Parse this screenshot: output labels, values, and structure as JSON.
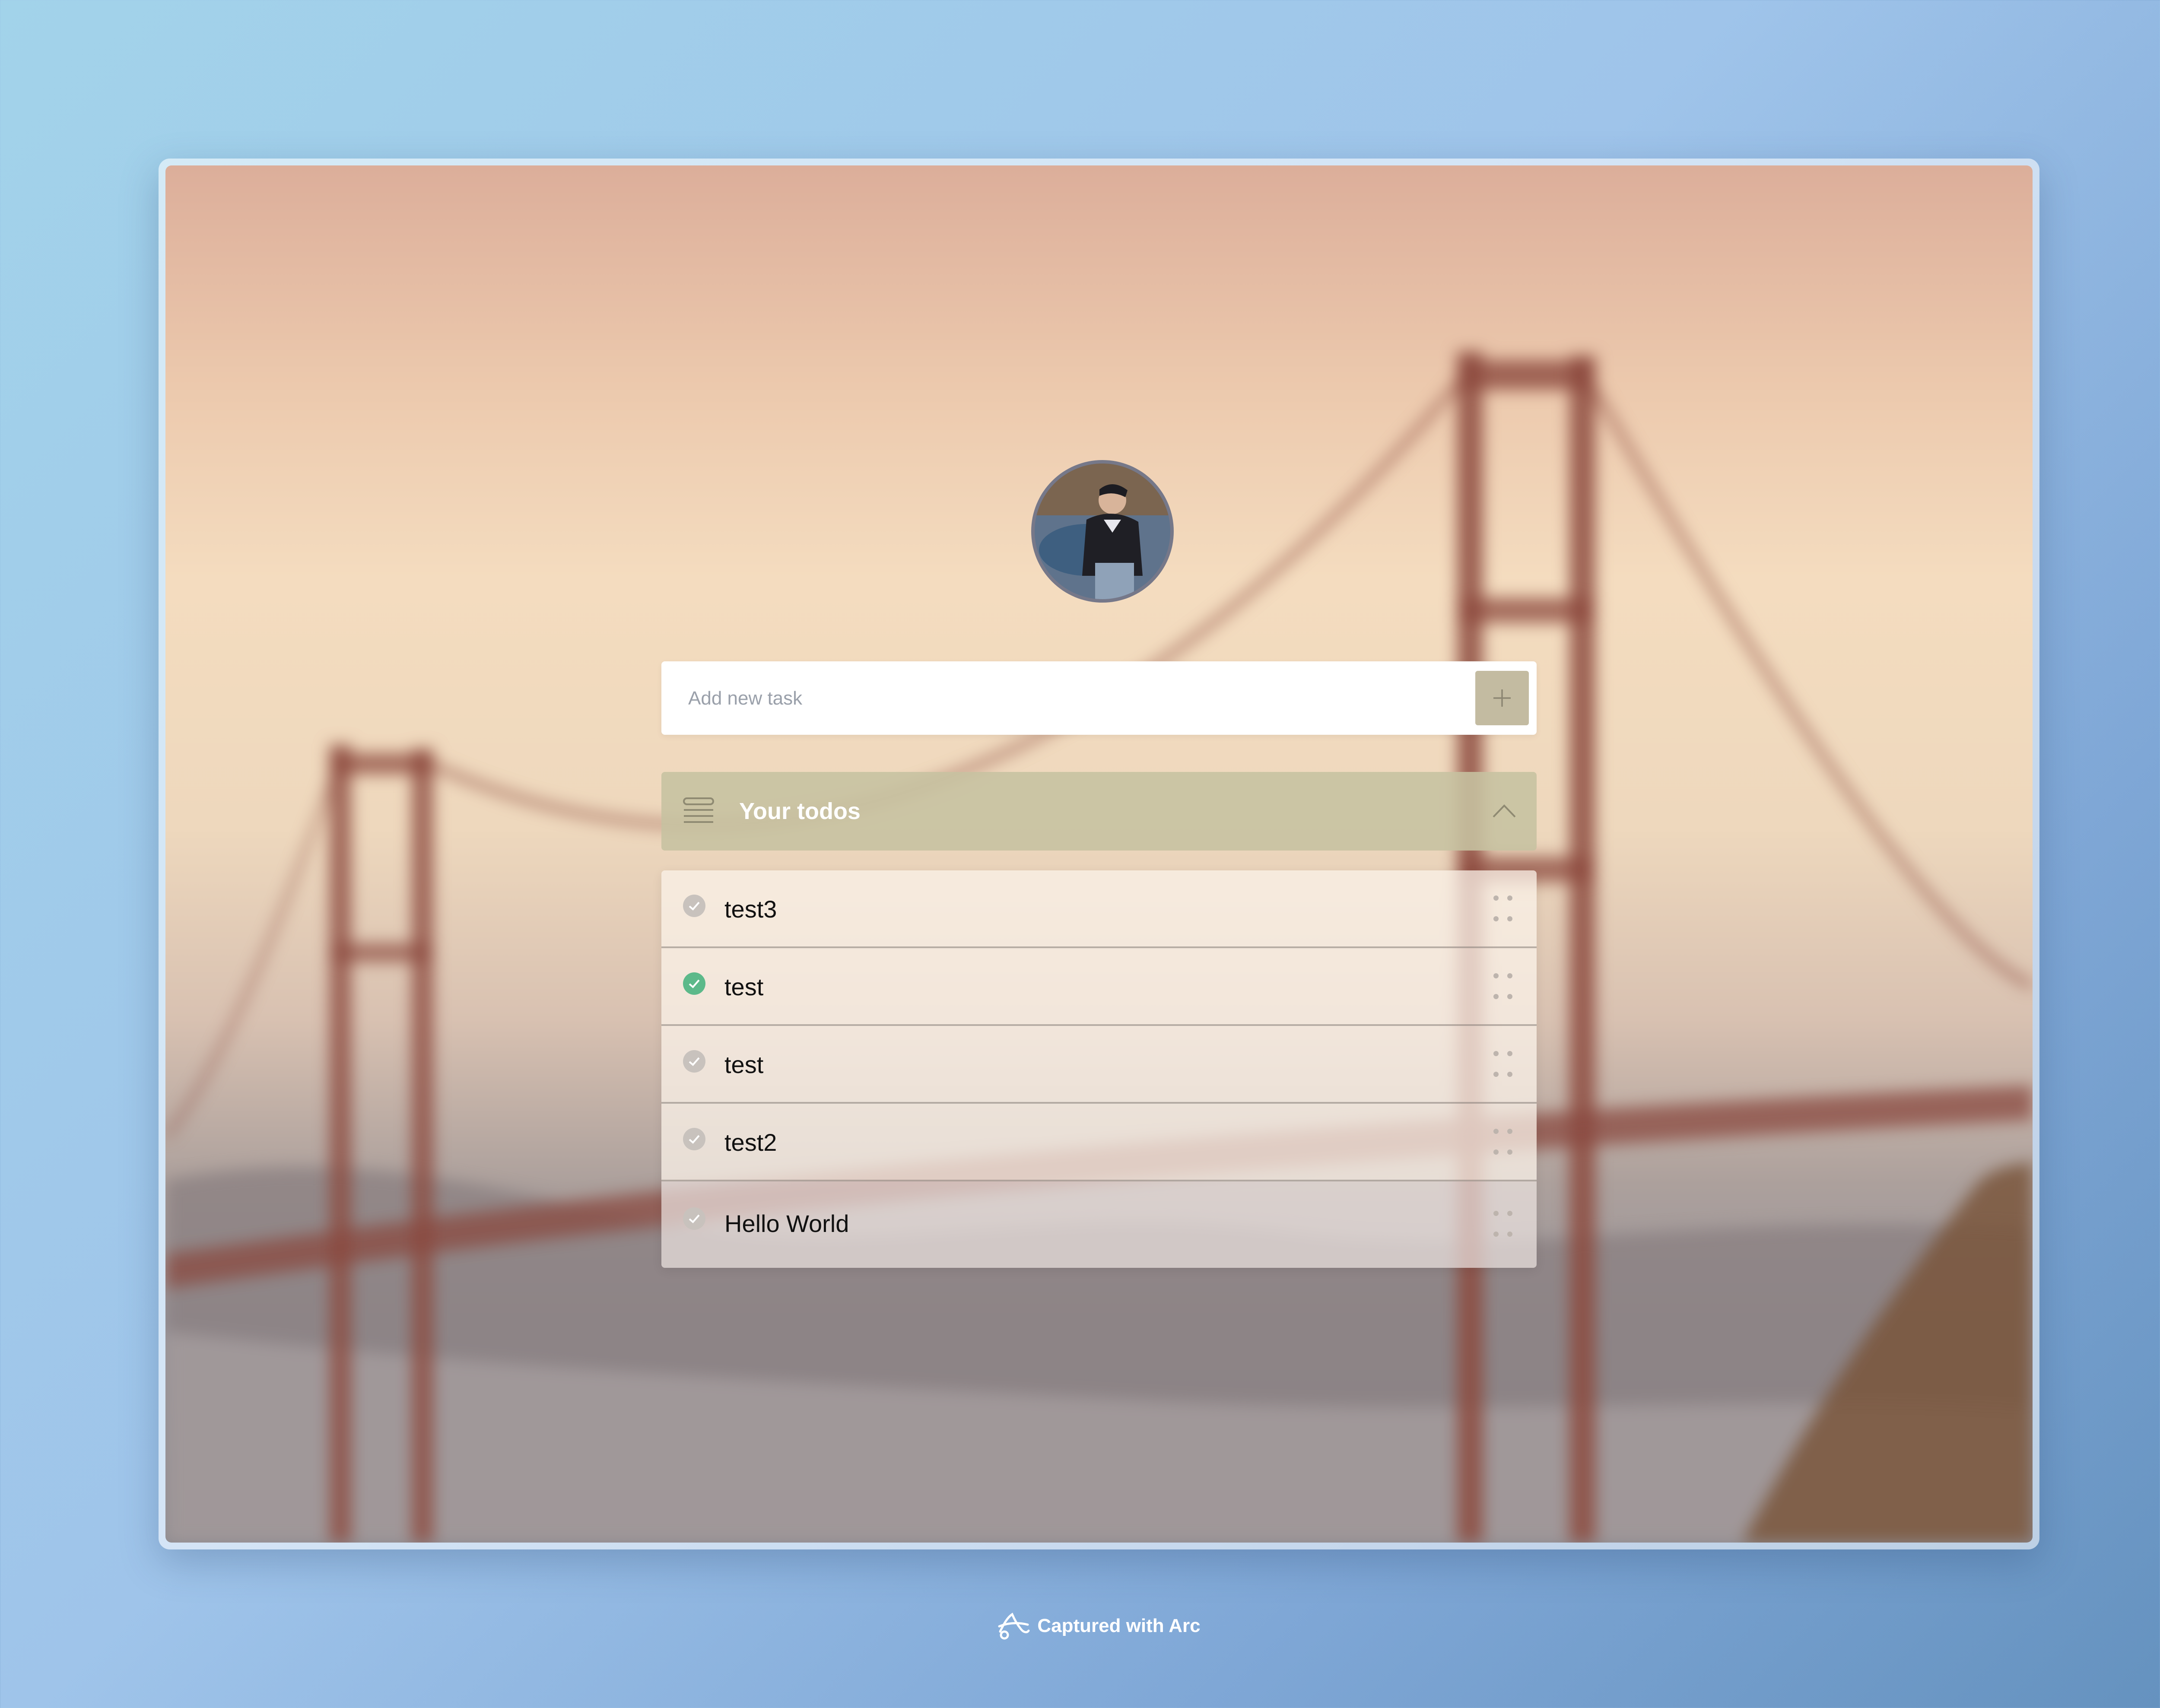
{
  "add_task": {
    "placeholder": "Add new task",
    "button_icon": "plus-icon"
  },
  "todos": {
    "title": "Your todos",
    "list_icon": "list-icon",
    "toggle_icon": "chevron-up-icon",
    "items": [
      {
        "label": "test3",
        "completed": false
      },
      {
        "label": "test",
        "completed": true
      },
      {
        "label": "test",
        "completed": false
      },
      {
        "label": "test2",
        "completed": false
      },
      {
        "label": "Hello World",
        "completed": false
      }
    ]
  },
  "footer": {
    "text": "Captured with Arc",
    "icon": "arc-logo-icon"
  },
  "colors": {
    "accent_add_button": "#c3bba1",
    "header_bg": "#c6c1a0",
    "check_done": "#5cb98a",
    "check_pending": "#c8c2bd"
  }
}
